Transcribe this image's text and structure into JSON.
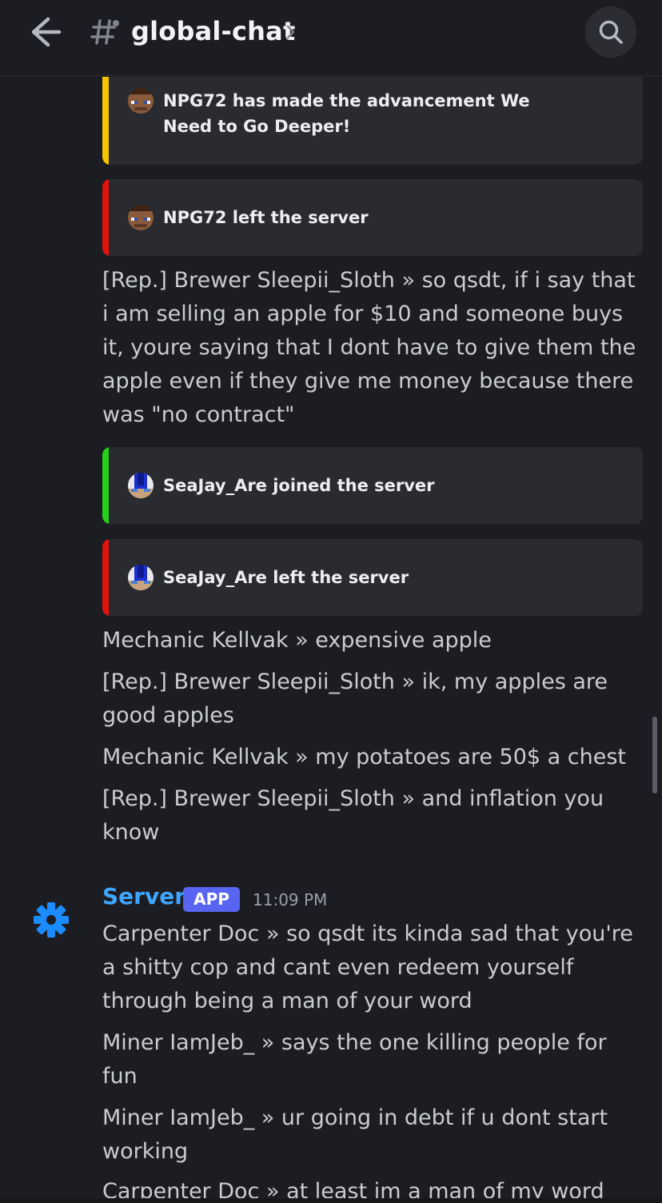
{
  "header": {
    "channel_name": "global-chat",
    "back_icon": "arrow-left-icon",
    "channel_icon": "hash-icon",
    "search_icon": "search-icon"
  },
  "embeds": [
    {
      "text": "NPG72 has made the advancement We Need to Go Deeper!",
      "color": "#f5c400",
      "avatar": "player-head-icon"
    },
    {
      "text": "NPG72 left the server",
      "color": "#e3120b",
      "avatar": "player-head-icon"
    },
    {
      "text": "SeaJay_Are joined the server",
      "color": "#23d11a",
      "avatar": "player-head-icon"
    },
    {
      "text": "SeaJay_Are left the server",
      "color": "#e3120b",
      "avatar": "player-head-icon"
    }
  ],
  "messages": [
    {
      "text": "[Rep.] Brewer Sleepii_Sloth » so qsdt, if i say that i am selling an apple for $10 and someone buys it, youre saying that I dont have to give them the apple even if they give me money because there was \"no contract\""
    },
    {
      "text": "Mechanic Kellvak » expensive apple"
    },
    {
      "text": "[Rep.] Brewer Sleepii_Sloth » ik, my apples are good apples"
    },
    {
      "text": "Mechanic Kellvak » my potatoes are 50$ a chest"
    },
    {
      "text": "[Rep.] Brewer Sleepii_Sloth » and inflation you know"
    }
  ],
  "server_group": {
    "author": "Server",
    "badge": "APP",
    "timestamp": "11:09 PM",
    "avatar_icon": "gear-icon",
    "messages": [
      {
        "text": "Carpenter Doc » so qsdt its kinda sad that you're a shitty cop and cant even redeem yourself through being a man of your word"
      },
      {
        "text": "Miner IamJeb_ » says the one killing people for fun"
      },
      {
        "text": "Miner IamJeb_ » ur going in debt if u dont start working"
      },
      {
        "text": "Carpenter Doc » at least im a man of my word"
      }
    ]
  },
  "colors": {
    "background": "#1c1d22",
    "embed_bg": "#2a2b30",
    "author_blue": "#3ea6ff",
    "badge": "#5865f2"
  }
}
